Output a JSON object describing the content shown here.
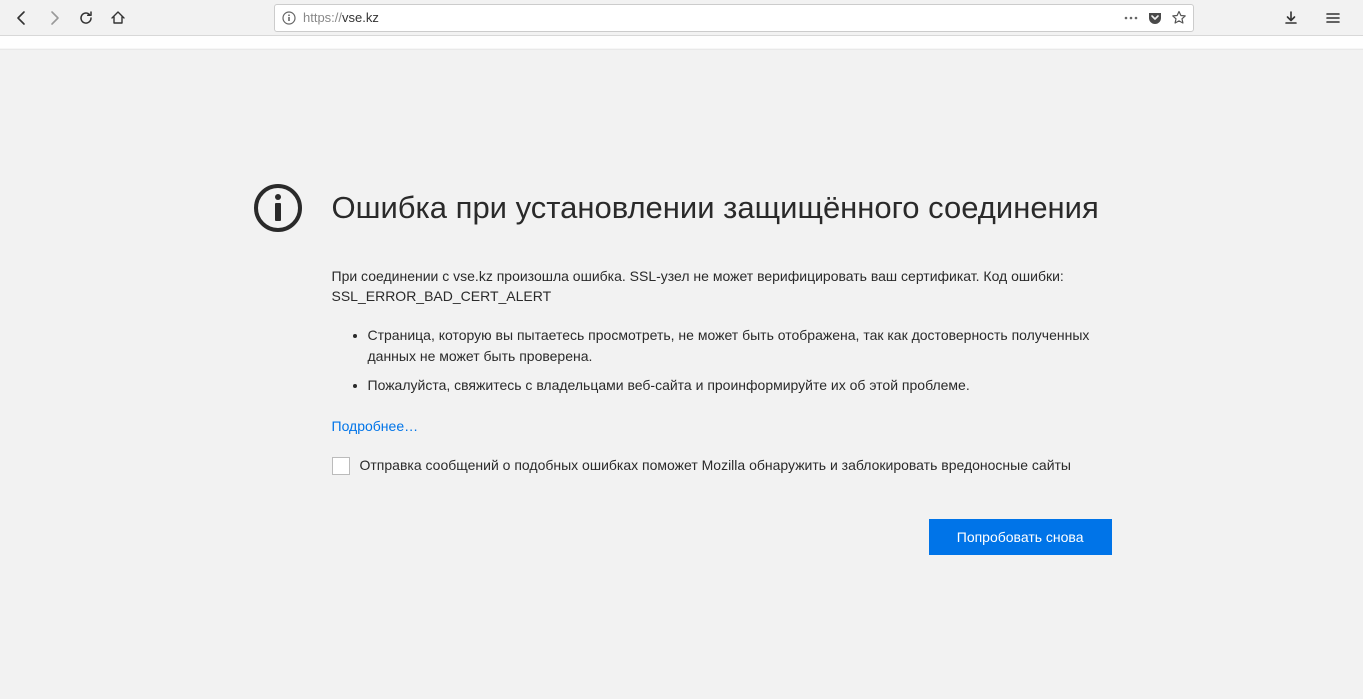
{
  "toolbar": {
    "url_scheme": "https://",
    "url_host": "vse.kz"
  },
  "error": {
    "title": "Ошибка при установлении защищённого соединения",
    "description": "При соединении с vse.kz произошла ошибка. SSL-узел не может верифицировать ваш сертификат. Код ошибки: SSL_ERROR_BAD_CERT_ALERT",
    "bullets": [
      "Страница, которую вы пытаетесь просмотреть, не может быть отображена, так как достоверность полученных данных не может быть проверена.",
      "Пожалуйста, свяжитесь с владельцами веб-сайта и проинформируйте их об этой проблеме."
    ],
    "learn_more": "Подробнее…",
    "report_label": "Отправка сообщений о подобных ошибках поможет Mozilla обнаружить и заблокировать вредоносные сайты",
    "retry_label": "Попробовать снова"
  }
}
